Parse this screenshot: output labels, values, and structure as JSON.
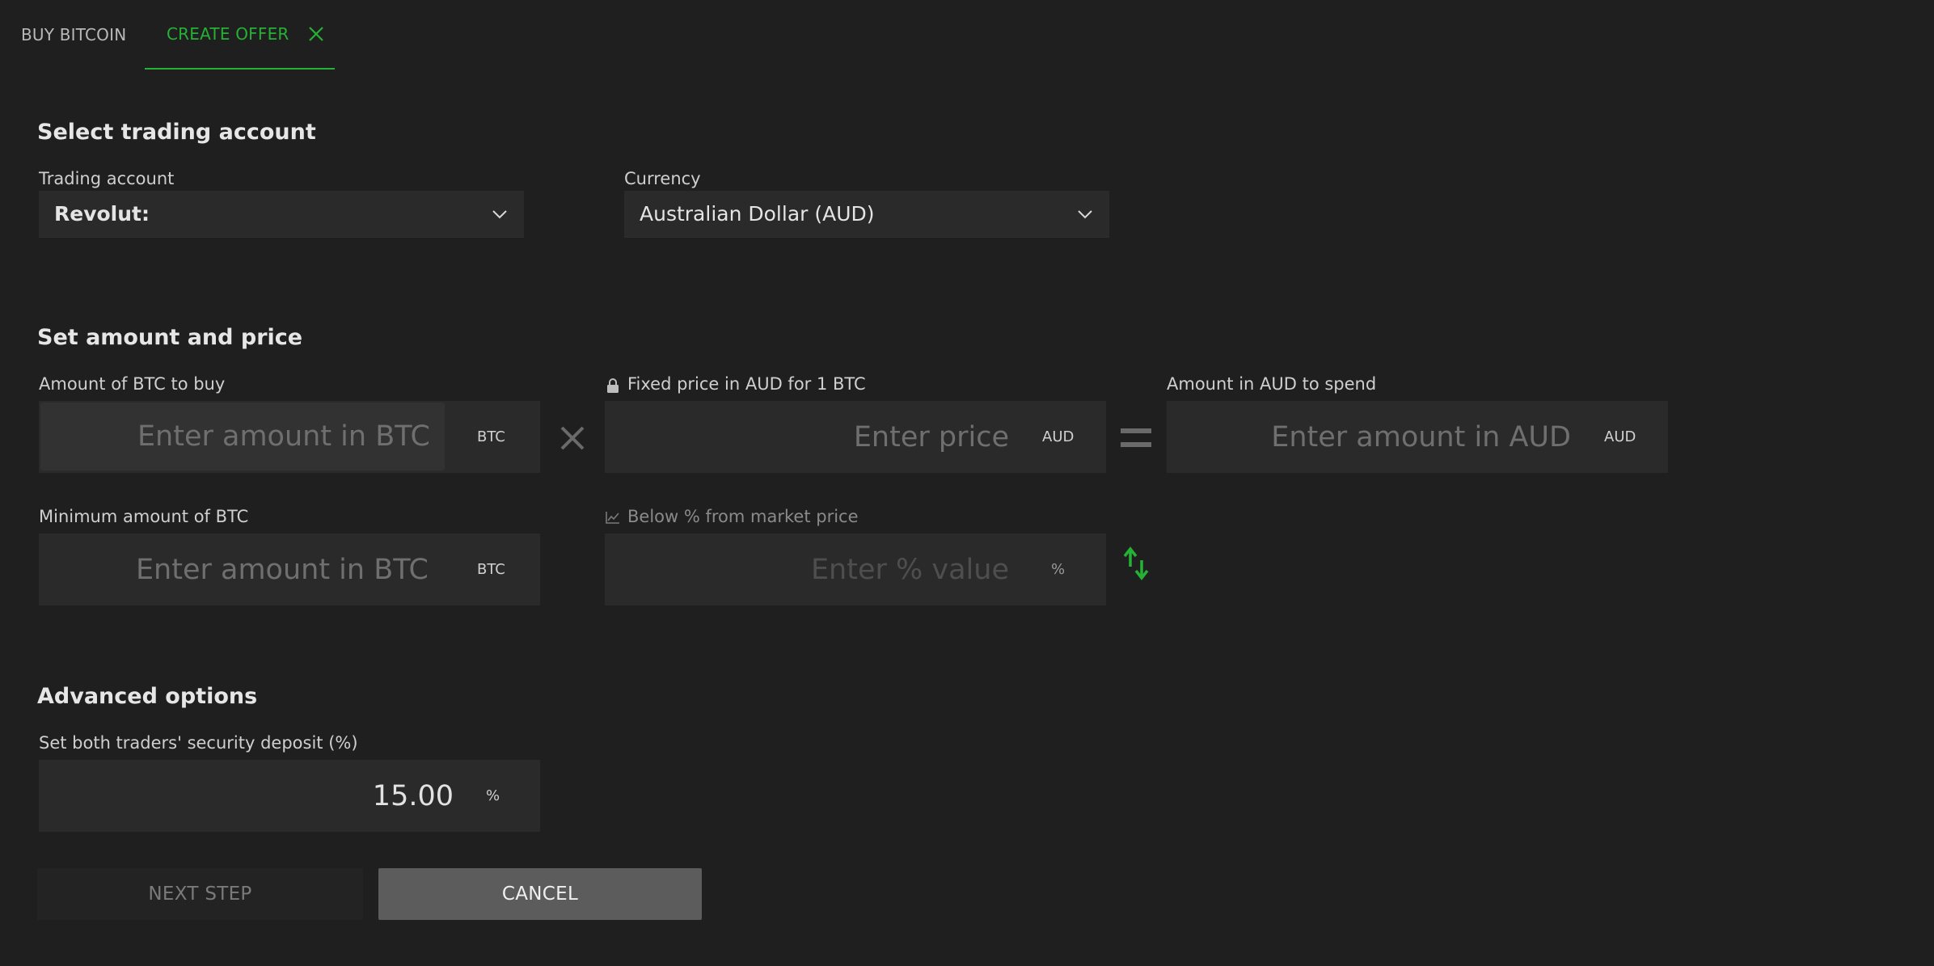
{
  "tabs": {
    "buy_label": "BUY BITCOIN",
    "create_label": "CREATE OFFER"
  },
  "trading_section": {
    "title": "Select trading account",
    "account_label": "Trading account",
    "account_value": "Revolut:",
    "currency_label": "Currency",
    "currency_value": "Australian Dollar (AUD)"
  },
  "amount_section": {
    "title": "Set amount and price",
    "btc_amount_label": "Amount of BTC to buy",
    "btc_amount_placeholder": "Enter amount in BTC",
    "btc_unit": "BTC",
    "price_label": "Fixed price in AUD for 1 BTC",
    "price_placeholder": "Enter price",
    "price_unit": "AUD",
    "spend_label": "Amount in AUD to spend",
    "spend_placeholder": "Enter amount in AUD",
    "spend_unit": "AUD",
    "min_label": "Minimum amount of BTC",
    "min_placeholder": "Enter amount in BTC",
    "min_unit": "BTC",
    "pct_label": "Below % from market price",
    "pct_placeholder": "Enter % value",
    "pct_unit": "%"
  },
  "advanced_section": {
    "title": "Advanced options",
    "deposit_label": "Set both traders' security deposit (%)",
    "deposit_value": "15.00",
    "deposit_unit": "%"
  },
  "actions": {
    "next_label": "NEXT STEP",
    "cancel_label": "CANCEL"
  },
  "colors": {
    "accent": "#25b135",
    "background": "#1f1f1f",
    "field": "#2a2a2b"
  },
  "icons": [
    "close-icon",
    "chevron-down-icon",
    "lock-icon",
    "multiply-icon",
    "equals-icon",
    "chart-icon",
    "swap-icon"
  ]
}
